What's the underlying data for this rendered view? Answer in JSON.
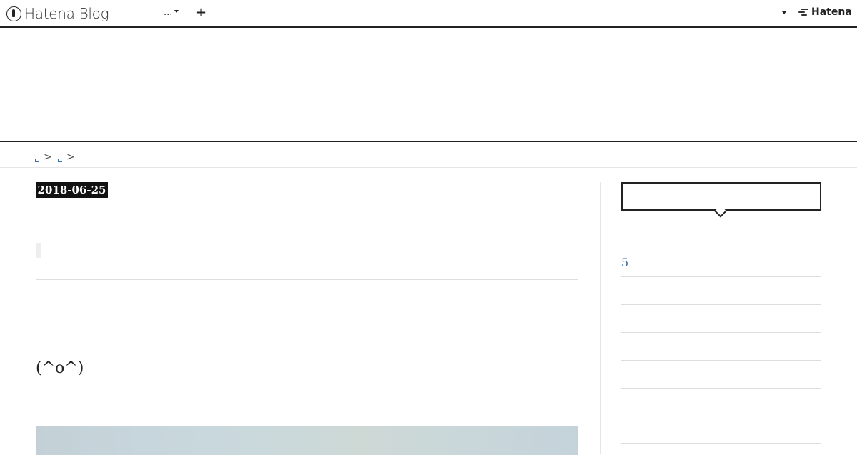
{
  "global_header": {
    "brand_text": "Hatena Blog",
    "more_menu_label": "...",
    "add_button_label": "+",
    "hatena_logo_text": "Hatena"
  },
  "breadcrumb": {
    "separator": ">"
  },
  "article": {
    "date": "2018-06-25",
    "body_text": "(^o^)"
  },
  "sidebar": {
    "list_items": [
      "5",
      "",
      "",
      "",
      "",
      "",
      ""
    ]
  },
  "colors": {
    "text": "#222222",
    "link": "#3a6ea5",
    "divider": "#dddddd",
    "badge_bg": "#111111"
  },
  "icons": {
    "brand": "hatena-blog-pen-icon",
    "add": "plus-icon",
    "menu": "chevron-down-icon",
    "hatena": "hatena-logo-icon"
  }
}
